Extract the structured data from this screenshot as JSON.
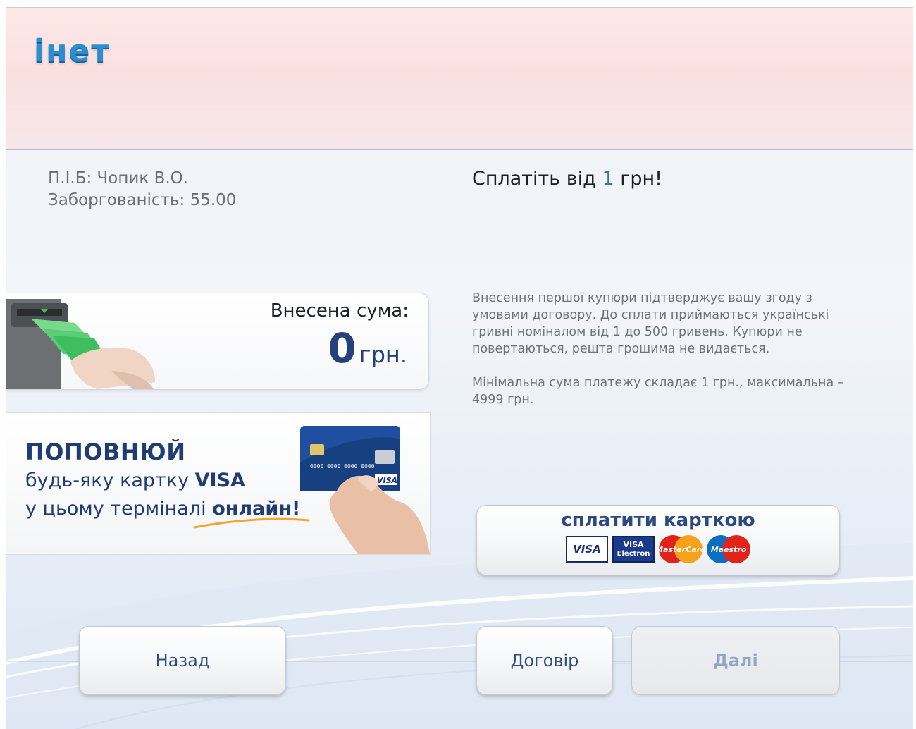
{
  "header": {
    "logo": "інет"
  },
  "customer": {
    "name_line": "П.І.Б: Чопик В.О.",
    "debt_line": "Заборгованість: 55.00"
  },
  "payment": {
    "title_prefix": "Сплатіть від ",
    "title_amount": "1",
    "title_suffix": " грн!"
  },
  "description": {
    "paragraph1": "Внесення першої купюри підтверджує вашу згоду з умовами договору. До сплати приймаються українські гривні номіналом від 1 до 500 гривень. Купюри не повертаються, решта грошима не видається.",
    "paragraph2": "Мінімальна сума платежу складає 1 грн., максимальна – 4999 грн."
  },
  "deposit": {
    "label": "Внесена сума:",
    "amount": "0",
    "currency": "грн."
  },
  "promo": {
    "line1": "ПОПОВНЮЙ",
    "line2_prefix": "будь-яку картку ",
    "line2_bold": "VISA",
    "line3_prefix": "у цьому терміналі ",
    "line3_bold": "онлайн!",
    "card_number": "0000 0000 0000 0000",
    "card_brand": "VISA"
  },
  "buttons": {
    "pay_card": "сплатити карткою",
    "back": "Назад",
    "contract": "Договір",
    "next": "Далі"
  },
  "card_logos": {
    "visa": "VISA",
    "visa_electron_top": "VISA",
    "visa_electron_bottom": "Electron",
    "mastercard": "MasterCard",
    "maestro": "Maestro"
  },
  "colors": {
    "accent_blue": "#2d4f86",
    "logo_blue": "#2a8fd0",
    "header_pink": "#fbe0df"
  }
}
